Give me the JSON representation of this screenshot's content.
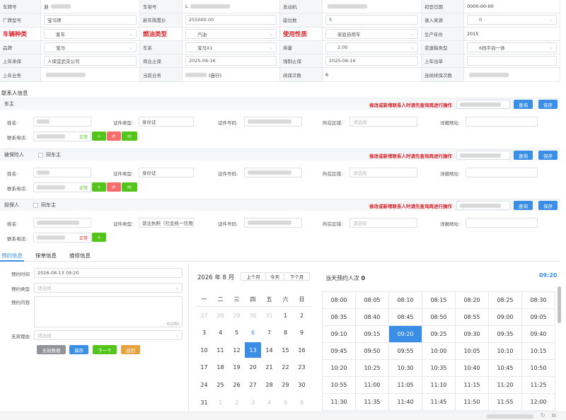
{
  "vehicle_grid": [
    {
      "label": "车牌号",
      "red": false,
      "value": "浙",
      "type": "text"
    },
    {
      "label": "车架号",
      "red": false,
      "value": "L",
      "type": "text"
    },
    {
      "label": "发动机",
      "red": false,
      "value": "",
      "type": "text"
    },
    {
      "label": "初登日期",
      "red": false,
      "value": "0000-00-00",
      "type": "text"
    },
    {
      "label": "厂牌型号",
      "red": false,
      "value": "宝马牌",
      "type": "input"
    },
    {
      "label": "新车购置价",
      "red": false,
      "value": "255000.00",
      "type": "input"
    },
    {
      "label": "座位数",
      "red": false,
      "value": "5",
      "type": "input"
    },
    {
      "label": "录入来源",
      "red": false,
      "value": "0",
      "type": "select"
    },
    {
      "label": "车辆种类",
      "red": true,
      "value": "客车",
      "type": "select"
    },
    {
      "label": "燃油类型",
      "red": true,
      "value": "汽油",
      "type": "select"
    },
    {
      "label": "使用性质",
      "red": true,
      "value": "家庭自用车",
      "type": "select"
    },
    {
      "label": "生产年份",
      "red": false,
      "value": "2015",
      "type": "text"
    },
    {
      "label": "品牌",
      "red": false,
      "value": "宝马",
      "type": "select"
    },
    {
      "label": "车系",
      "red": false,
      "value": "宝马X1",
      "type": "select"
    },
    {
      "label": "排量",
      "red": false,
      "value": "2.00",
      "type": "select"
    },
    {
      "label": "变速箱类型",
      "red": false,
      "value": "6挡手自一体",
      "type": "select"
    },
    {
      "label": "上年承保",
      "red": false,
      "value": "人保宜武支公司",
      "type": "input"
    },
    {
      "label": "商业止保",
      "red": false,
      "value": "2025-06-16",
      "type": "input"
    },
    {
      "label": "强制止保",
      "red": false,
      "value": "2025-06-16",
      "type": "input"
    },
    {
      "label": "上年出单",
      "red": false,
      "value": "",
      "type": "input"
    },
    {
      "label": "上年业务",
      "red": false,
      "value": "",
      "type": "text"
    },
    {
      "label": "当前业务",
      "red": false,
      "value": "(自行)",
      "type": "text"
    },
    {
      "label": "续保次数",
      "red": false,
      "value": "6",
      "type": "text"
    },
    {
      "label": "连续续保次数",
      "red": false,
      "value": "",
      "type": "text"
    }
  ],
  "contacts_title": "联系人信息",
  "warn_text": "修改或新增联系人时请先查询再进行操作",
  "labels": {
    "name": "姓名:",
    "id_type": "证件类型:",
    "id_no": "证件号码:",
    "region": "所在区域:",
    "address": "详细地址:",
    "phone": "联系电话:",
    "same_owner": "同车主"
  },
  "placeholders": {
    "region": "请选择"
  },
  "buttons": {
    "query": "查询",
    "save": "保存",
    "plus": "+"
  },
  "parties": [
    {
      "title": "车主",
      "id_type": "身份证",
      "phone_status": "正常",
      "has_same": false
    },
    {
      "title": "被保险人",
      "id_type": "身份证",
      "phone_status": "正常",
      "has_same": true
    },
    {
      "title": "投保人",
      "id_type": "营业执照（社会统一信用代",
      "phone_status": "正常",
      "has_same": true
    }
  ],
  "tabs": [
    "预约信息",
    "保单信息",
    "维修信息"
  ],
  "appointment": {
    "time_label": "预约时间",
    "time_value": "2026-08-13 09:20",
    "type_label": "预约类型",
    "type_placeholder": "请选择",
    "content_label": "预约内容",
    "counter": "0/200",
    "invalid_label": "无效理由",
    "invalid_placeholder": "请选择",
    "btn_invalid": "无效数据",
    "btn_save": "保存",
    "btn_next": "下一个",
    "btn_back": "返回"
  },
  "calendar": {
    "title": "2026 年 8 月",
    "prev": "上个月",
    "today": "今天",
    "next": "下个月",
    "weekdays": [
      "一",
      "二",
      "三",
      "四",
      "五",
      "六",
      "日"
    ],
    "days": [
      [
        "27",
        "28",
        "29",
        "30",
        "31",
        "1",
        "2"
      ],
      [
        "3",
        "4",
        "5",
        "6",
        "7",
        "8",
        "9"
      ],
      [
        "10",
        "11",
        "12",
        "13",
        "14",
        "15",
        "16"
      ],
      [
        "17",
        "18",
        "19",
        "20",
        "21",
        "22",
        "23"
      ],
      [
        "24",
        "25",
        "26",
        "27",
        "28",
        "29",
        "30"
      ],
      [
        "31",
        "1",
        "2",
        "3",
        "4",
        "5",
        "6"
      ]
    ]
  },
  "slots": {
    "title": "当天预约人次",
    "count": "0",
    "selected_time": "09:20",
    "times": [
      "08:00",
      "08:05",
      "08:10",
      "08:15",
      "08:20",
      "08:25",
      "08:30",
      "08:35",
      "08:40",
      "08:45",
      "08:50",
      "08:55",
      "09:00",
      "09:05",
      "09:10",
      "09:15",
      "09:20",
      "09:25",
      "09:30",
      "09:35",
      "09:40",
      "09:45",
      "09:50",
      "09:55",
      "10:00",
      "10:05",
      "10:10",
      "10:15",
      "10:20",
      "10:25",
      "10:30",
      "10:35",
      "10:40",
      "10:45",
      "10:50",
      "10:55",
      "11:00",
      "11:05",
      "11:10",
      "11:15",
      "11:20",
      "11:25",
      "11:30",
      "11:35",
      "11:40",
      "11:45",
      "11:50",
      "11:55",
      "12:00"
    ]
  },
  "colors": {
    "accent": "#3a8ee6",
    "danger": "#d9222a",
    "success": "#52c41a"
  }
}
